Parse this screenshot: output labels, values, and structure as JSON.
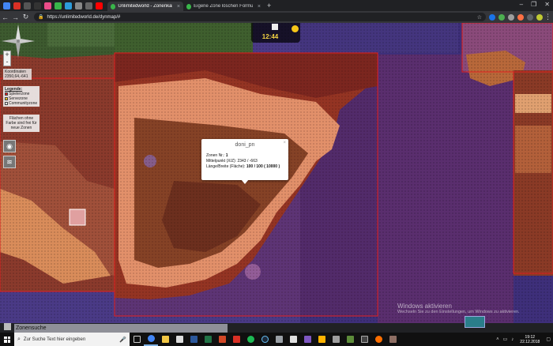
{
  "browser": {
    "tabs": [
      {
        "title": "Unlimitedworld - Zonenkarte",
        "active": true
      },
      {
        "title": "Eigene Zone löschen Formular |",
        "active": false
      }
    ],
    "url": "https://unlimitedworld.de/dynmap/#"
  },
  "map": {
    "zoom_in": "+",
    "zoom_out": "-",
    "coords_label": "Koordinaten",
    "coords_value": "2350,64,-641",
    "legend": {
      "title": "Legende:",
      "items": [
        {
          "label": "Spielerzone",
          "color": "#e21f1f"
        },
        {
          "label": "Servezone",
          "color": "#f5c518"
        },
        {
          "label": "Communityzone",
          "color": "#ffffff"
        }
      ]
    },
    "hint": "Flächen ohne Farbe sind frei für neue Zonen",
    "clock_time": "12:44"
  },
  "popup": {
    "title": "doni_pn",
    "close": "×",
    "zone_label": "Zonen Nr.:",
    "zone_value": "1",
    "center_label": "Mittelpunkt (X/Z):",
    "center_value": "2343 / -663",
    "size_label": "Länge/Breite (Fläche):",
    "size_value": "100 / 100 ( 10000 )"
  },
  "windows_notice": {
    "title": "Windows aktivieren",
    "subtitle": "Wechseln Sie zu den Einstellungen, um Windows zu aktivieren."
  },
  "zone_search": {
    "label": "Zonensuche"
  },
  "taskbar": {
    "search_placeholder": "Zur Suche Text hier eingeben",
    "time": "19:12",
    "date": "22.12.2018"
  }
}
